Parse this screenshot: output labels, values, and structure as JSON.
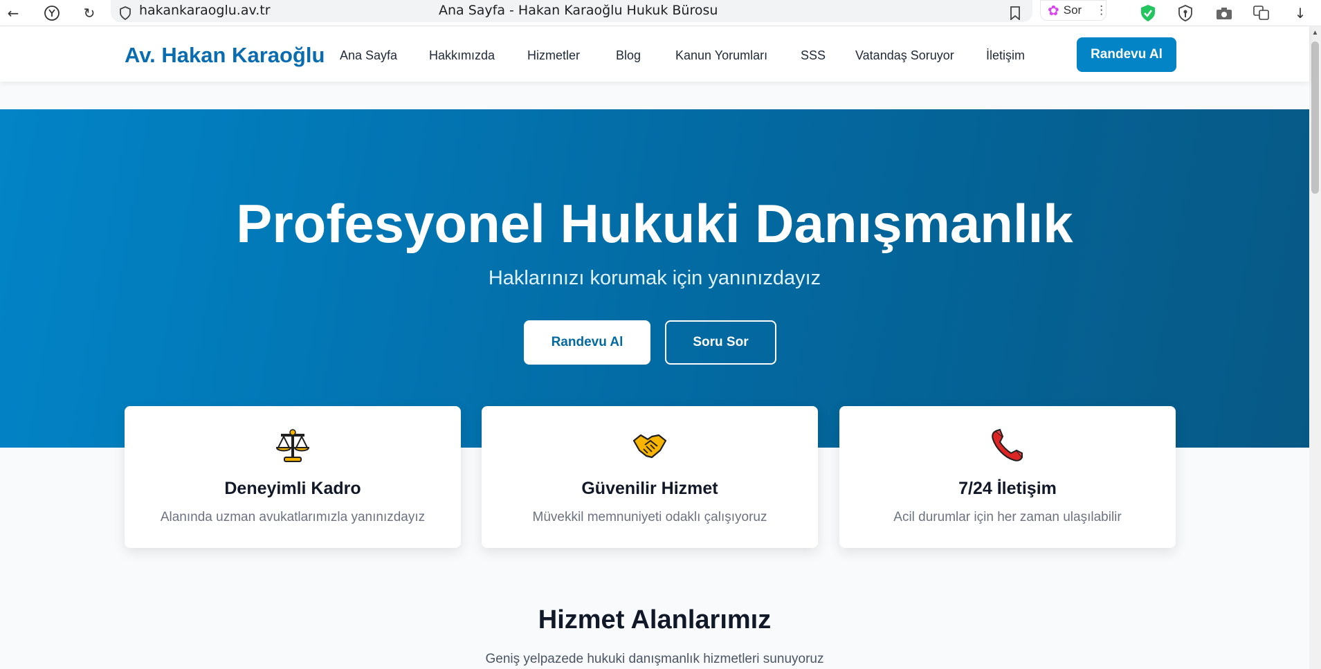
{
  "browser": {
    "url": "hakankaraoglu.av.tr",
    "tab_title": "Ana Sayfa - Hakan Karaoğlu Hukuk Bürosu",
    "sor_label": "Sor",
    "back_icon": "back-arrow-icon",
    "reload_icon": "reload-icon"
  },
  "nav": {
    "logo": "Av. Hakan Karaoğlu",
    "links": [
      "Ana Sayfa",
      "Hakkımızda",
      "Hizmetler",
      "Blog",
      "Kanun Yorumları",
      "SSS",
      "Vatandaş Soruyor",
      "İletişim"
    ],
    "cta": "Randevu Al"
  },
  "hero": {
    "title": "Profesyonel Hukuki Danışmanlık",
    "subtitle": "Haklarınızı korumak için yanınızdayız",
    "primary_button": "Randevu Al",
    "secondary_button": "Soru Sor"
  },
  "features": [
    {
      "icon": "scales-icon",
      "title": "Deneyimli Kadro",
      "desc": "Alanında uzman avukatlarımızla yanınızdayız"
    },
    {
      "icon": "handshake-icon",
      "title": "Güvenilir Hizmet",
      "desc": "Müvekkil memnuniyeti odaklı çalışıyoruz"
    },
    {
      "icon": "phone-icon",
      "title": "7/24 İletişim",
      "desc": "Acil durumlar için her zaman ulaşılabilir"
    }
  ],
  "services": {
    "title": "Hizmet Alanlarımız",
    "subtitle": "Geniş yelpazede hukuki danışmanlık hizmetleri sunuyoruz"
  },
  "colors": {
    "brand": "#0284c7",
    "hero_dark": "#075985"
  }
}
